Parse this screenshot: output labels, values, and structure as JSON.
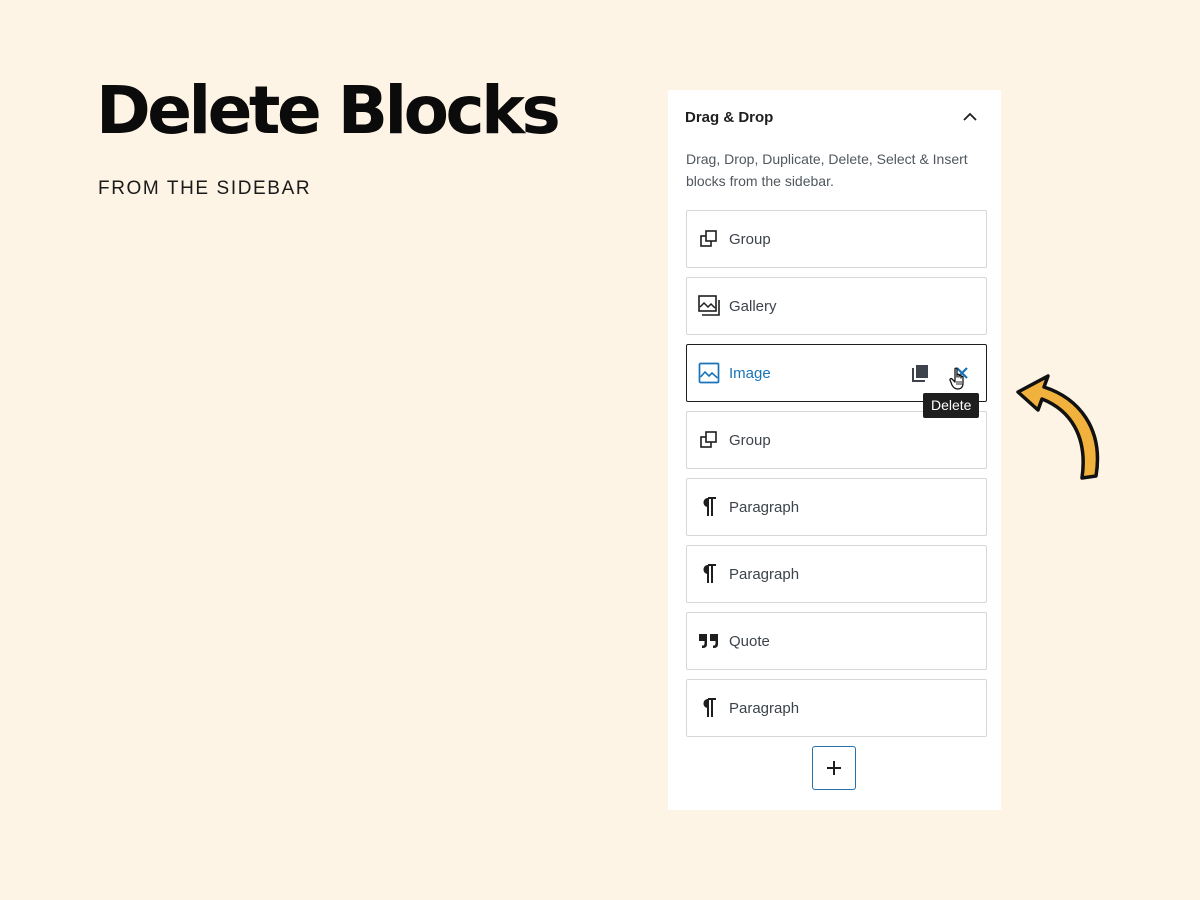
{
  "hero": {
    "title": "Delete Blocks",
    "subtitle": "FROM THE SIDEBAR"
  },
  "panel": {
    "title": "Drag & Drop",
    "collapse_icon": "chevron-up-icon",
    "description": "Drag, Drop, Duplicate, Delete, Select & Insert blocks from the sidebar."
  },
  "blocks": [
    {
      "label": "Group",
      "icon": "group-icon"
    },
    {
      "label": "Gallery",
      "icon": "gallery-icon"
    },
    {
      "label": "Image",
      "icon": "image-icon",
      "active": true
    },
    {
      "label": "Group",
      "icon": "group-icon"
    },
    {
      "label": "Paragraph",
      "icon": "paragraph-icon"
    },
    {
      "label": "Paragraph",
      "icon": "paragraph-icon"
    },
    {
      "label": "Quote",
      "icon": "quote-icon"
    },
    {
      "label": "Paragraph",
      "icon": "paragraph-icon"
    }
  ],
  "actions": {
    "duplicate_icon": "duplicate-icon",
    "delete_icon": "close-icon",
    "delete_tooltip": "Delete"
  },
  "add_button": {
    "icon": "plus-icon",
    "label": "+"
  },
  "colors": {
    "background": "#fdf4e5",
    "accent": "#1a73b8",
    "arrow": "#f0b23c",
    "tooltip_bg": "#1e1e1e"
  }
}
